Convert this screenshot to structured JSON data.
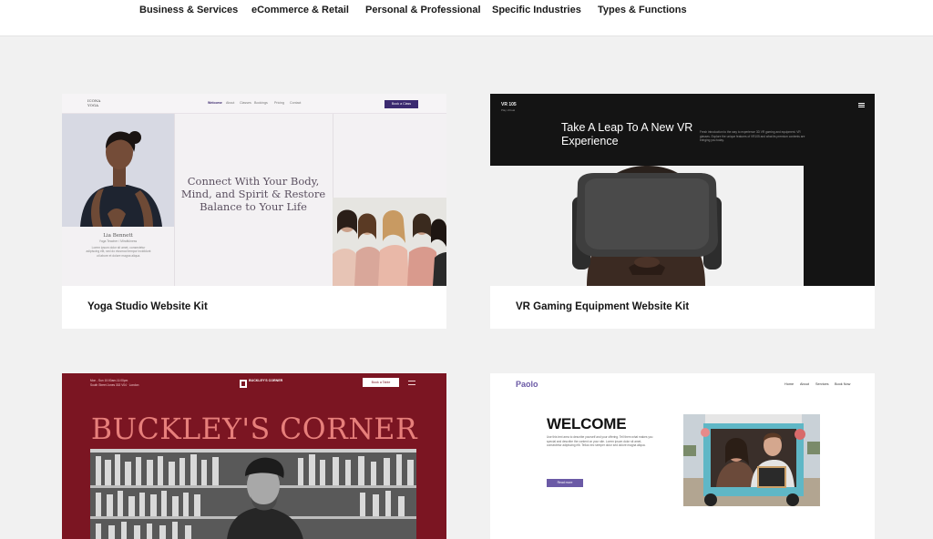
{
  "nav": {
    "items": [
      {
        "label": "Business & Services"
      },
      {
        "label": "eCommerce & Retail"
      },
      {
        "label": "Personal & Professional"
      },
      {
        "label": "Specific Industries"
      },
      {
        "label": "Types & Functions"
      }
    ]
  },
  "templates": {
    "yoga": {
      "caption": "Yoga Studio Website Kit",
      "logo": "ICONA YOGA",
      "nav": [
        "Welcome",
        "About",
        "Classes",
        "Bookings",
        "Pricing",
        "Contact"
      ],
      "button": "Book a Class",
      "headline": "Connect With Your Body, Mind, and Spirit & Restore Balance to Your Life",
      "instructor_name": "Lia Bennett",
      "instructor_role": "Yoga Teacher / Mindfulness",
      "bio": "Lorem ipsum dolor sit amet, consectetur adipiscing elit, sed do eiusmod tempor incididunt ut labore et dolore magna aliqua."
    },
    "vr": {
      "caption": "VR Gaming Equipment Website Kit",
      "logo": "VR 105",
      "logo_sub": "Play Virtual",
      "headline": "Take A Leap To A New VR Experience",
      "paragraph": "Fresh introduction to the way to experience 3D VR gaming and equipment. VR glasses. Explore the unique features of VR105 and what its premium contents are bringing you today."
    },
    "buckley": {
      "title": "BUCKLEY'S CORNER",
      "logo_text": "BUCKLEY'S CORNER",
      "hours": "Mon - Sun 10:00am-11:00pm",
      "address": "South Street Jones 302 V04 · London",
      "button": "Book a Table"
    },
    "paolo": {
      "logo": "Paolo",
      "nav": [
        "Home",
        "About",
        "Services",
        "Book Now"
      ],
      "headline": "WELCOME",
      "paragraph": "Use this text area to describe yourself and your offering. Tell them what makes you special and describe the content on your site. Lorem ipsum dolor sit amet, consectetur adipiscing elit. Tellus nec semper dolor sed dolore magna aliqua.",
      "button": "Read more"
    }
  },
  "colors": {
    "page_bg": "#f1f1f1",
    "yoga_accent": "#3b2a70",
    "buckley_bg": "#7b1522",
    "buckley_title": "#e77f7b",
    "paolo_accent": "#6b5aa6",
    "vr_bg": "#141414"
  }
}
